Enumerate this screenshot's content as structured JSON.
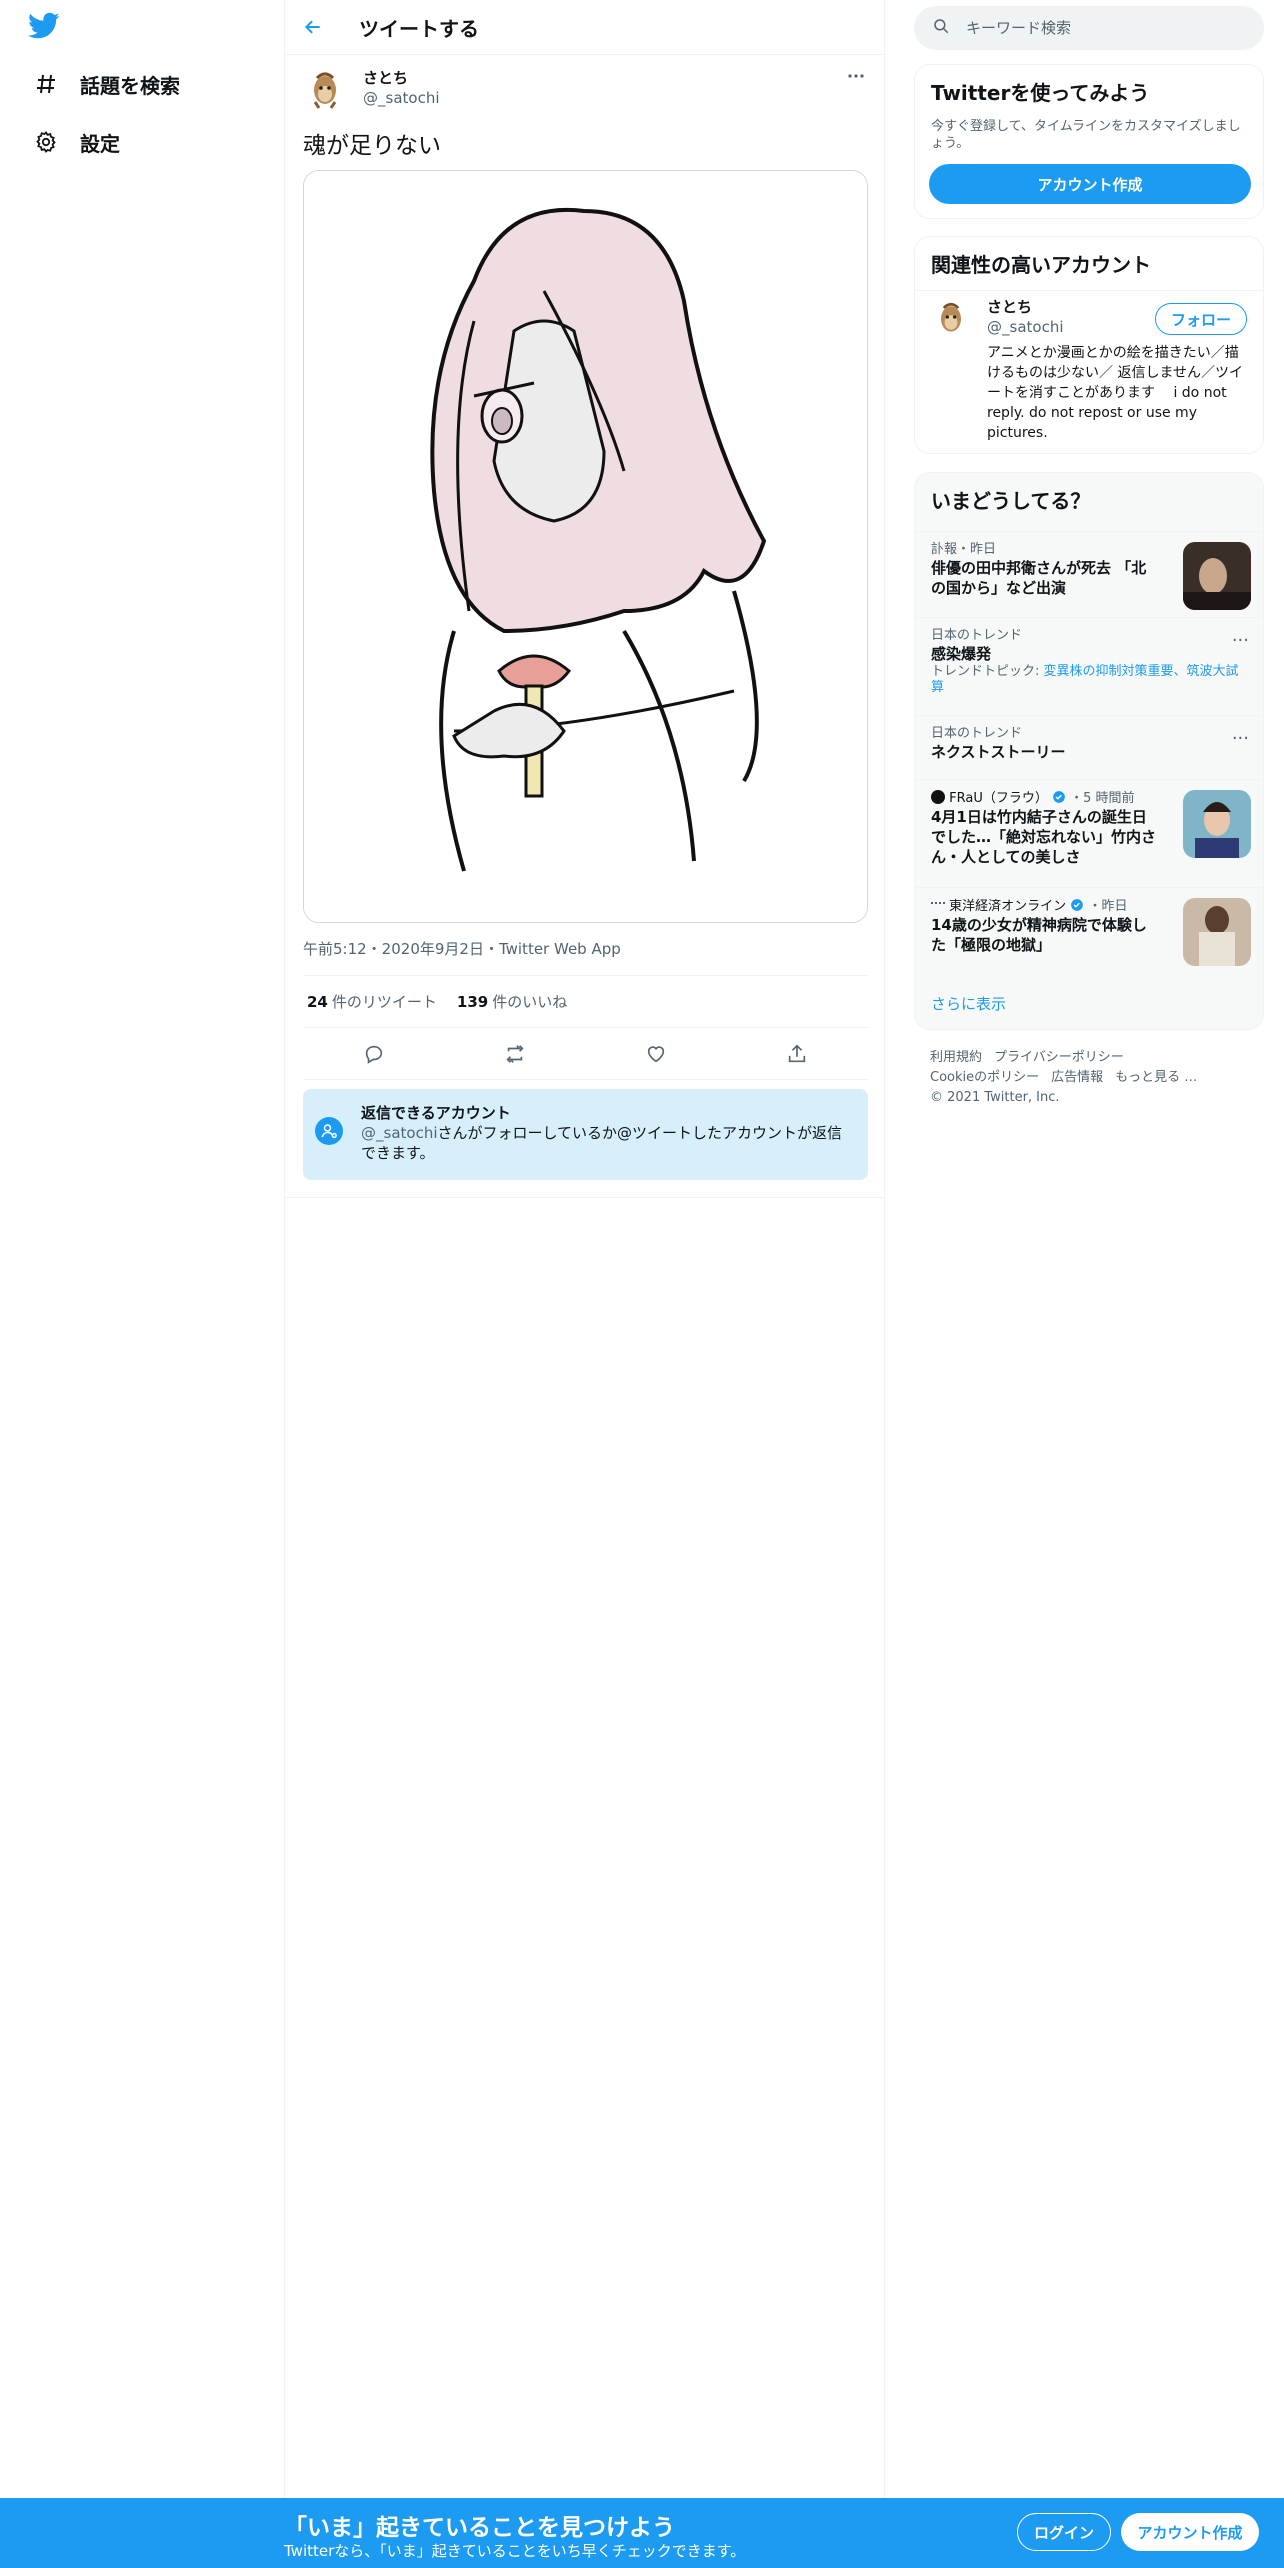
{
  "nav": {
    "logo_icon": "twitter-bird-icon",
    "items": [
      {
        "label": "話題を検索",
        "icon": "hashtag-icon"
      },
      {
        "label": "設定",
        "icon": "gear-icon"
      }
    ]
  },
  "header": {
    "title": "ツイートする",
    "back_icon": "arrow-left-icon"
  },
  "tweet": {
    "author_name": "さとち",
    "author_handle": "@_satochi",
    "text": "魂が足りない",
    "meta": "午前5:12・2020年9月2日・Twitter Web App",
    "retweets_count": "24",
    "retweets_label": "件のリツイート",
    "likes_count": "139",
    "likes_label": "件のいいね"
  },
  "reply_notice": {
    "title": "返信できるアカウント",
    "handle": "@_satochi",
    "body": "さんがフォローしているか@ツイートしたアカウントが返信できます。"
  },
  "search": {
    "placeholder": "キーワード検索"
  },
  "signup_card": {
    "title": "Twitterを使ってみよう",
    "desc": "今すぐ登録して、タイムラインをカスタマイズしましょう。",
    "button": "アカウント作成"
  },
  "related": {
    "title": "関連性の高いアカウント",
    "name": "さとち",
    "handle": "@_satochi",
    "follow": "フォロー",
    "bio": "アニメとか漫画とかの絵を描きたい／描けるものは少ない／ 返信しません／ツイートを消すことがあります　 i do not reply. do not repost or use my pictures."
  },
  "trends": {
    "title": "いまどうしてる？",
    "items": [
      {
        "meta": "訃報・昨日",
        "title": "俳優の田中邦衛さんが死去 「北の国から」など出演"
      },
      {
        "meta": "日本のトレンド",
        "title": "感染爆発",
        "sub_prefix": "トレンドトピック: ",
        "sub_link": "変異株の抑制対策重要、筑波大試算"
      },
      {
        "meta": "日本のトレンド",
        "title": "ネクストストーリー"
      },
      {
        "source": "FRaU（フラウ）",
        "time": "・5 時間前",
        "title": "4月1日は竹内結子さんの誕生日でした…「絶対忘れない」竹内さん・人としての美しさ"
      },
      {
        "source": "東洋経済オンライン",
        "time": "・昨日",
        "title": "14歳の少女が精神病院で体験した「極限の地獄」"
      }
    ],
    "show_more": "さらに表示"
  },
  "footer": {
    "links1": [
      "利用規約",
      "プライバシーポリシー"
    ],
    "links2": [
      "Cookieのポリシー",
      "広告情報",
      "もっと見る …"
    ],
    "copyright": "© 2021 Twitter, Inc."
  },
  "bottom_bar": {
    "title": "「いま」起きていることを見つけよう",
    "subtitle": "Twitterなら、「いま」起きていることをいち早くチェックできます。",
    "login": "ログイン",
    "signup": "アカウント作成"
  },
  "colors": {
    "brand": "#1d9bf0",
    "notice_bg": "#d7effb"
  }
}
